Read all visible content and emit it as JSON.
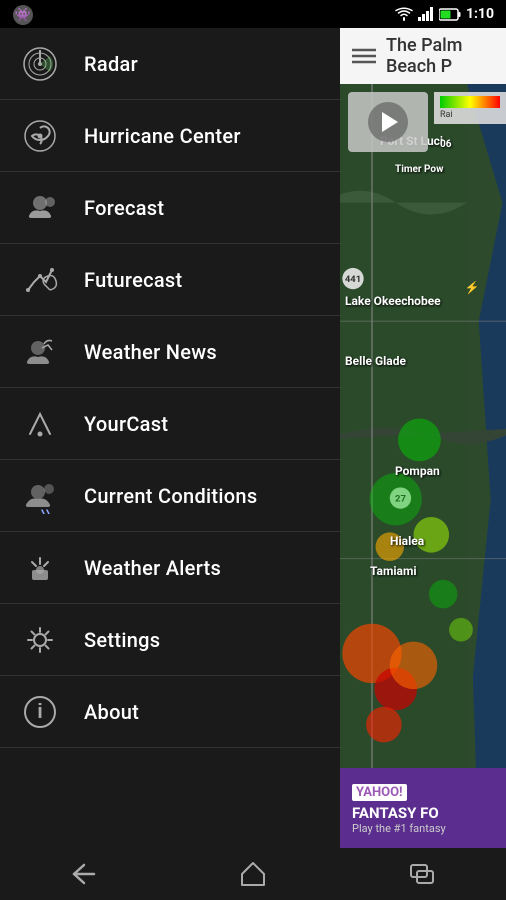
{
  "statusBar": {
    "time": "1:10",
    "batteryIcon": "battery-icon",
    "wifiIcon": "wifi-icon",
    "signalIcon": "signal-icon"
  },
  "sidebar": {
    "items": [
      {
        "id": "radar",
        "label": "Radar",
        "icon": "radar-icon"
      },
      {
        "id": "hurricane-center",
        "label": "Hurricane Center",
        "icon": "hurricane-icon"
      },
      {
        "id": "forecast",
        "label": "Forecast",
        "icon": "forecast-icon"
      },
      {
        "id": "futurecast",
        "label": "Futurecast",
        "icon": "futurecast-icon"
      },
      {
        "id": "weather-news",
        "label": "Weather News",
        "icon": "weather-news-icon"
      },
      {
        "id": "yourcast",
        "label": "YourCast",
        "icon": "yourcast-icon"
      },
      {
        "id": "current-conditions",
        "label": "Current Conditions",
        "icon": "current-conditions-icon"
      },
      {
        "id": "weather-alerts",
        "label": "Weather Alerts",
        "icon": "weather-alerts-icon"
      },
      {
        "id": "settings",
        "label": "Settings",
        "icon": "settings-icon"
      },
      {
        "id": "about",
        "label": "About",
        "icon": "about-icon"
      }
    ]
  },
  "rightPanel": {
    "title": "The Palm Beach P",
    "mapLabels": {
      "portStLucie": "Port St Luci",
      "lakeOkeechobee": "Lake Okeechobee",
      "belleGlade": "Belle Glade",
      "pompano": "Pompan",
      "hialeah": "Hialea",
      "tamiami": "Tamiami",
      "timerPow": "Timer Pow",
      "corridorLabel": "06"
    }
  },
  "adBanner": {
    "brandTop": "YAHOO!",
    "title": "FANTASY FO",
    "subtitle": "Play the #1 fantasy"
  },
  "bottomNav": {
    "back": "back-button",
    "home": "home-button",
    "recent": "recent-apps-button"
  }
}
